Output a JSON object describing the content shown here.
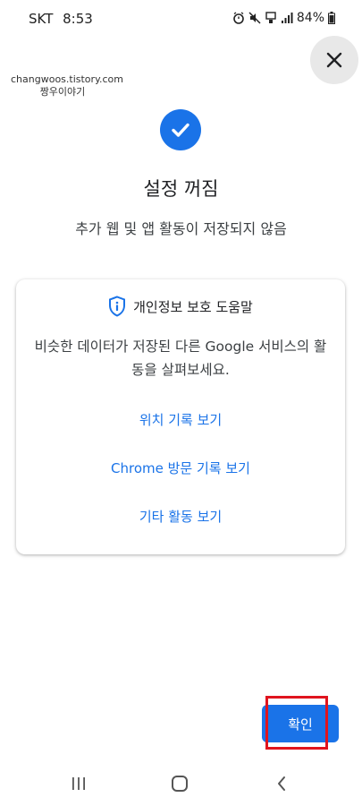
{
  "status_bar": {
    "carrier": "SKT",
    "time": "8:53",
    "battery": "84%"
  },
  "watermark": {
    "line1": "changwoos.tistory.com",
    "line2": "짱우이야기"
  },
  "header": {
    "title": "설정 꺼짐",
    "subtitle": "추가 웹 및 앱 활동이 저장되지 않음"
  },
  "card": {
    "title": "개인정보 보호 도움말",
    "description": "비슷한 데이터가 저장된 다른 Google 서비스의 활동을 살펴보세요.",
    "links": [
      "위치 기록 보기",
      "Chrome 방문 기록 보기",
      "기타 활동 보기"
    ]
  },
  "actions": {
    "confirm_label": "확인"
  },
  "colors": {
    "accent": "#1a73e8",
    "highlight": "#e0141e"
  },
  "icons": {
    "close": "close-icon",
    "check": "check-icon",
    "shield": "shield-info-icon"
  }
}
